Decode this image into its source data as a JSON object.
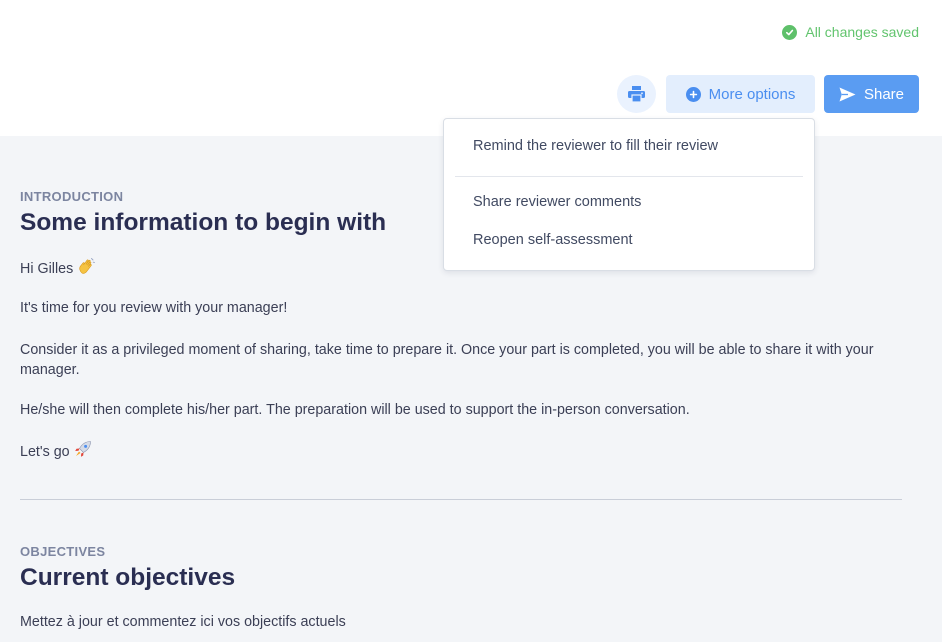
{
  "header": {
    "saved_status": "All changes saved",
    "more_options_label": "More options",
    "share_label": "Share"
  },
  "dropdown": {
    "items": [
      "Remind the reviewer to fill their review",
      "Share reviewer comments",
      "Reopen self-assessment"
    ]
  },
  "introduction": {
    "label": "INTRODUCTION",
    "title": "Some information to begin with",
    "greeting": "Hi Gilles",
    "paragraphs": [
      "It's time for you review with your manager!",
      "Consider it as a privileged moment of sharing, take time to prepare it. Once your part is completed, you will be able to share it with your manager.",
      "He/she will then complete his/her part. The preparation will be used to support the in-person conversation."
    ],
    "closing": "Let's go"
  },
  "objectives": {
    "label": "OBJECTIVES",
    "title": "Current objectives",
    "description": "Mettez à jour et commentez ici vos objectifs actuels"
  },
  "icons": {
    "saved": "check-circle-icon",
    "print": "printer-icon",
    "more_options": "plus-circle-icon",
    "share": "send-icon",
    "greeting_emoji": "waving-hand-icon",
    "closing_emoji": "rocket-icon"
  },
  "colors": {
    "accent": "#5a9cf2",
    "success": "#5ec06a",
    "title": "#2a2e52",
    "background": "#f3f5f8"
  }
}
